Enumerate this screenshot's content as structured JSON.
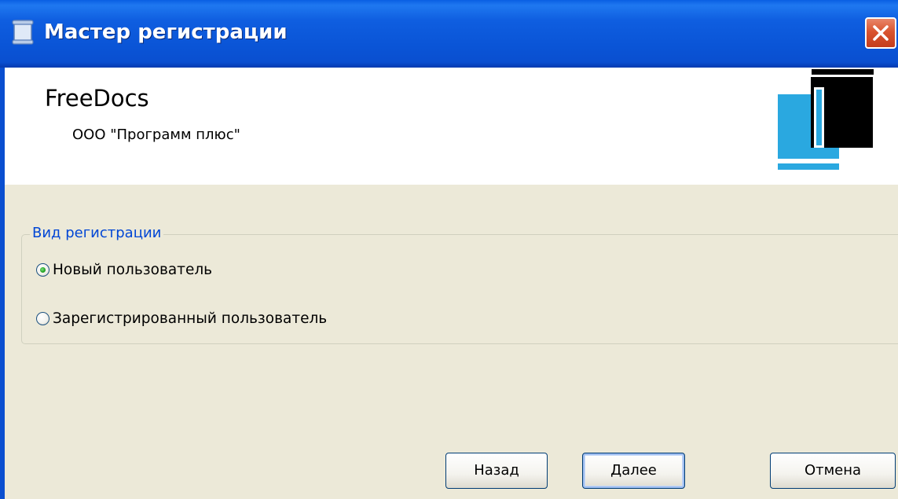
{
  "window": {
    "title": "Мастер регистрации",
    "icon": "scroll-icon",
    "close_icon": "close-icon"
  },
  "header": {
    "app_name": "FreeDocs",
    "company": "ООО \"Программ плюс\"",
    "logo": "freedocs-logo"
  },
  "registration": {
    "group_title": "Вид регистрации",
    "options": [
      {
        "label": "Новый пользователь",
        "selected": true
      },
      {
        "label": "Зарегистрированный пользователь",
        "selected": false
      }
    ]
  },
  "buttons": {
    "back": "Назад",
    "next": "Далее",
    "cancel": "Отмена"
  },
  "colors": {
    "titlebar": "#0a54d6",
    "dialog_background": "#ece9d8",
    "groupbox_title": "#0046d5",
    "logo_blue": "#2aa8e0",
    "logo_black": "#000000"
  }
}
